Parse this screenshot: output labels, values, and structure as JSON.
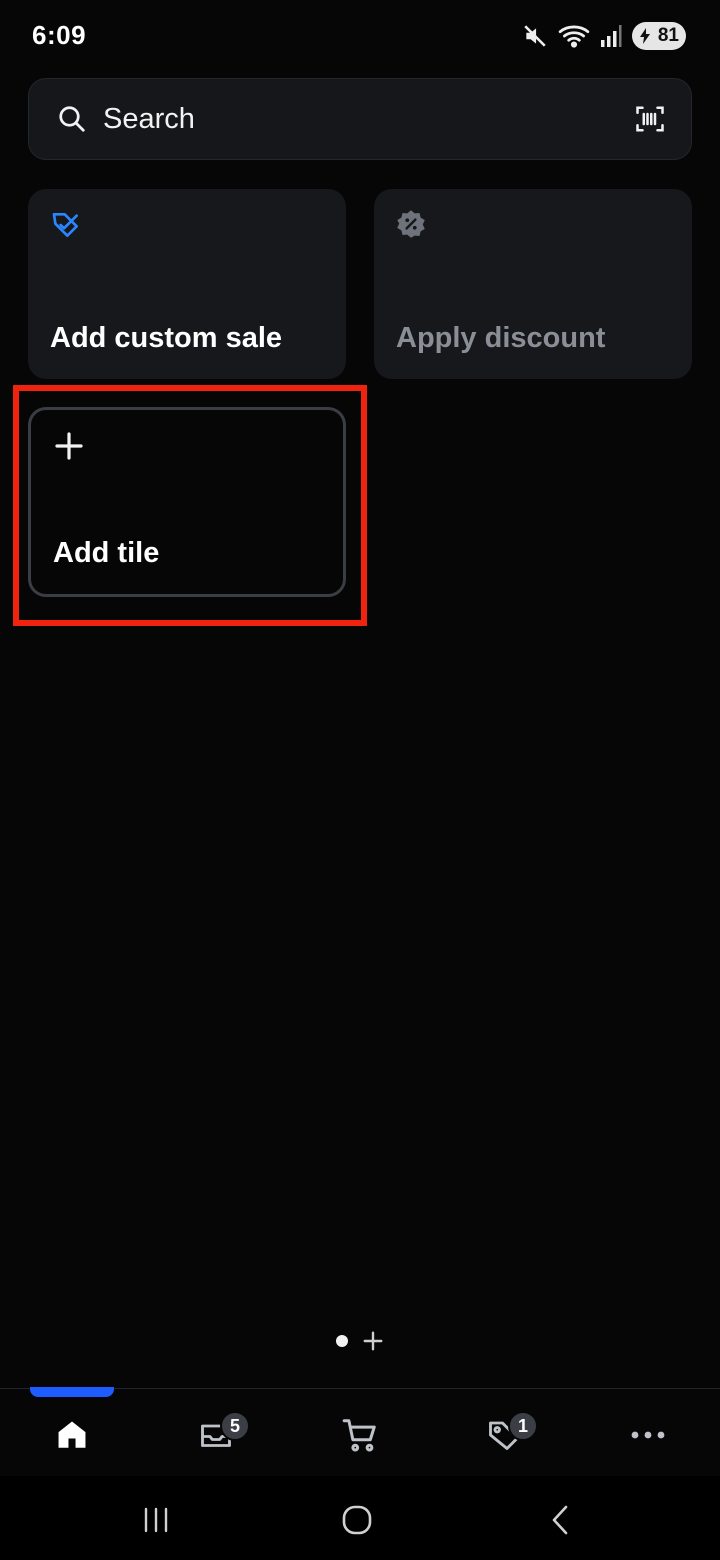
{
  "status_bar": {
    "time": "6:09",
    "battery_level": "81",
    "icons": [
      "mute-icon",
      "wifi-icon",
      "signal-icon",
      "battery-icon"
    ]
  },
  "search": {
    "label": "Search",
    "icon": "search-icon",
    "scan_icon": "barcode-scan-icon"
  },
  "tiles": [
    {
      "label": "Add custom sale",
      "icon": "tag-edit-icon",
      "icon_color": "#2a86ff"
    },
    {
      "label": "Apply discount",
      "icon": "discount-badge-icon",
      "icon_color": "#6e727a",
      "disabled": true
    },
    {
      "label": "Add tile",
      "icon": "plus-icon"
    }
  ],
  "page_indicator": {
    "pages": 1,
    "current": 1,
    "add_icon": "plus-icon"
  },
  "bottom_nav": {
    "active": "home",
    "items": [
      {
        "name": "home",
        "icon": "home-icon"
      },
      {
        "name": "orders",
        "icon": "inbox-icon",
        "badge": "5"
      },
      {
        "name": "cart",
        "icon": "cart-icon"
      },
      {
        "name": "discounts",
        "icon": "tag-icon",
        "badge": "1"
      },
      {
        "name": "more",
        "icon": "more-icon"
      }
    ]
  },
  "colors": {
    "background": "#060606",
    "tile": "#16181c",
    "accent": "#1f5cff",
    "highlight": "#f0230f"
  }
}
